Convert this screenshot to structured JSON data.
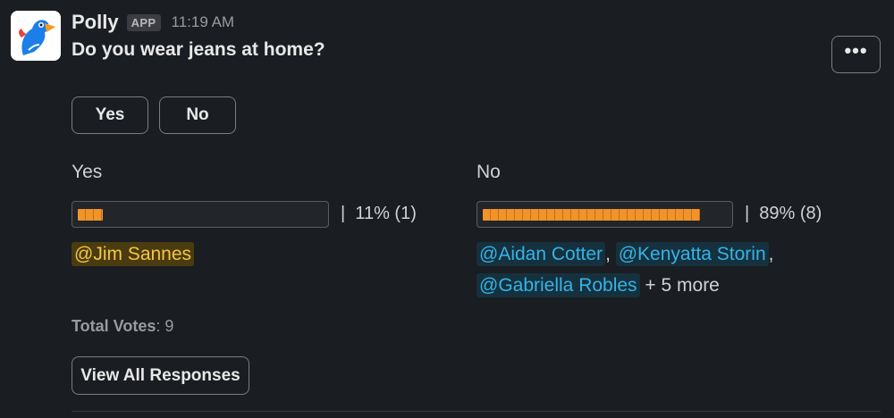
{
  "app": {
    "name": "Polly",
    "badge": "APP",
    "timestamp": "11:19 AM",
    "avatar_icon": "polly-parrot-logo"
  },
  "poll": {
    "question": "Do you wear jeans at home?",
    "more_button": "•••",
    "vote_buttons": [
      {
        "label": "Yes"
      },
      {
        "label": "No"
      }
    ],
    "options": [
      {
        "label": "Yes",
        "percent": 11,
        "result": "|  11% (1)",
        "voters": [
          {
            "name": "@Jim Sannes"
          }
        ]
      },
      {
        "label": "No",
        "percent": 89,
        "result": "|  89% (8)",
        "voters": [
          {
            "name": "@Aidan Cotter"
          },
          {
            "name": "@Kenyatta Storin"
          },
          {
            "name": "@Gabriella Robles"
          }
        ],
        "more": "+ 5 more"
      }
    ],
    "total_label": "Total Votes",
    "total_value": ": 9",
    "view_all_label": "View All Responses"
  },
  "colors": {
    "background": "#1a1d21",
    "bar_fill": "#f0932b",
    "self_mention_bg": "#4b3b10",
    "self_mention_text": "#f2c744",
    "mention_bg": "#15313d",
    "mention_text": "#36b2e8"
  }
}
